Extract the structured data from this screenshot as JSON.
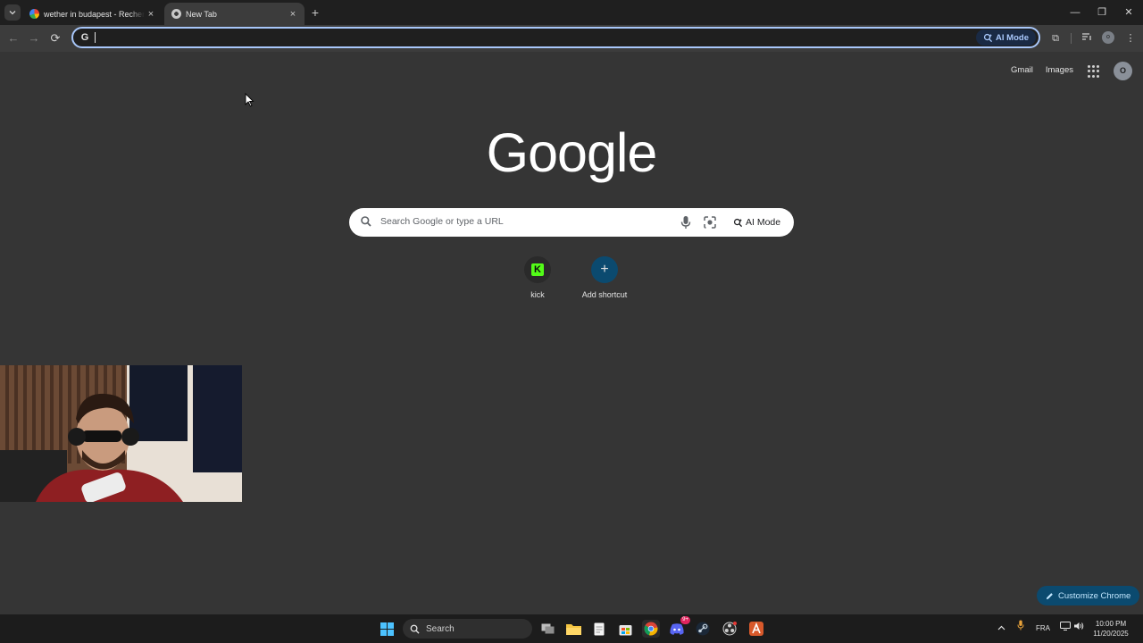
{
  "tabs": [
    {
      "title": "wether in budapest - Recherche Google",
      "active": false,
      "favicon": "google-icon"
    },
    {
      "title": "New Tab",
      "active": true,
      "favicon": "chrome-icon"
    }
  ],
  "tab_close_glyph": "×",
  "new_tab_glyph": "+",
  "window_controls": {
    "minimize": "—",
    "restore": "❐",
    "close": "✕"
  },
  "toolbar": {
    "back_glyph": "←",
    "forward_glyph": "→",
    "reload_glyph": "⟳",
    "omnibox_value": "",
    "omnibox_ai_label": "AI Mode",
    "extensions_glyph": "⧉",
    "menu_glyph": "⋮",
    "profile_initial": "o"
  },
  "ntp": {
    "top_links": [
      "Gmail",
      "Images"
    ],
    "avatar_initial": "O",
    "logo_text": "Google",
    "search_placeholder": "Search Google or type a URL",
    "ai_mode_label": "AI Mode",
    "shortcuts": [
      {
        "label": "kick",
        "icon": "kick-icon"
      },
      {
        "label": "Add shortcut",
        "icon": "plus-icon"
      }
    ],
    "customize_label": "Customize Chrome"
  },
  "taskbar": {
    "search_label": "Search",
    "language": "FRA",
    "time": "10:00 PM",
    "date": "11/20/2025",
    "discord_badge": "9+"
  },
  "colors": {
    "page_bg": "#353535",
    "toolbar_bg": "#3c3c3c",
    "tabstrip_bg": "#1f1f1f",
    "accent": "#a8c7fa",
    "customize_bg": "#0b4a6f",
    "kick_green": "#53fc18"
  }
}
